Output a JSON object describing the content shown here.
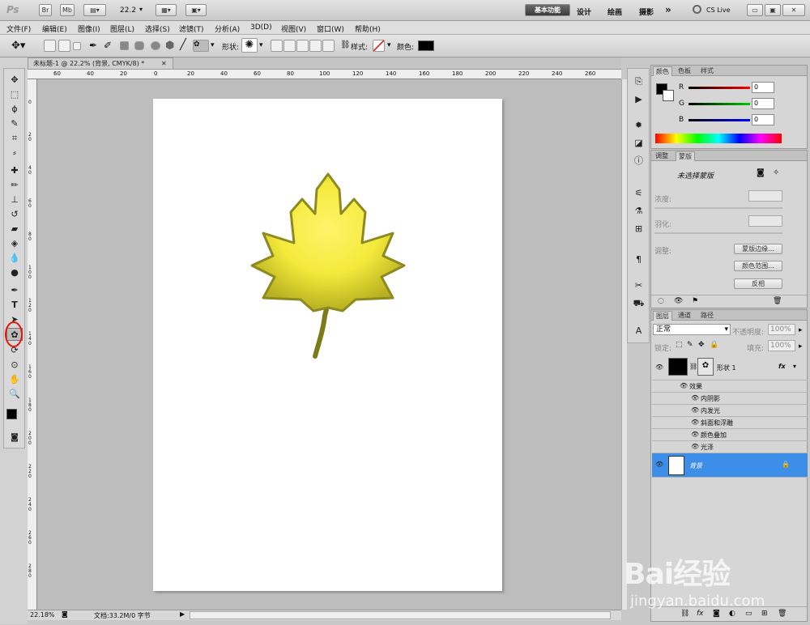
{
  "app": {
    "logo": "Ps",
    "bridge": "Br",
    "minibridge": "Mb",
    "zoom_value": "22.2",
    "workspaces": [
      "基本功能",
      "设计",
      "绘画",
      "摄影"
    ],
    "more": "»",
    "cslive": "CS Live"
  },
  "menu": [
    "文件(F)",
    "编辑(E)",
    "图像(I)",
    "图层(L)",
    "选择(S)",
    "滤镜(T)",
    "分析(A)",
    "3D(D)",
    "视图(V)",
    "窗口(W)",
    "帮助(H)"
  ],
  "options": {
    "shape_label": "形状:",
    "style_label": "样式:",
    "color_label": "颜色:"
  },
  "document": {
    "tab_title": "未标题-1 @ 22.2% (背景, CMYK/8) *",
    "zoom_status": "22.18%",
    "status_text": "文档:33.2M/0 字节"
  },
  "ruler": {
    "h": [
      "60",
      "40",
      "20",
      "0",
      "20",
      "40",
      "60",
      "80",
      "100",
      "120",
      "140",
      "160",
      "180",
      "200",
      "220",
      "240",
      "260"
    ],
    "v": [
      "0",
      "2 0",
      "4 0",
      "6 0",
      "8 0",
      "1 0 0",
      "1 2 0",
      "1 4 0",
      "1 6 0",
      "1 8 0",
      "2 0 0",
      "2 2 0",
      "2 4 0",
      "2 6 0",
      "2 8 0"
    ]
  },
  "color_panel": {
    "tabs": [
      "颜色",
      "色板",
      "样式"
    ],
    "channels": [
      {
        "label": "R",
        "value": "0"
      },
      {
        "label": "G",
        "value": "0"
      },
      {
        "label": "B",
        "value": "0"
      }
    ]
  },
  "masks_panel": {
    "tabs": [
      "调整",
      "蒙版"
    ],
    "title": "未选择蒙版",
    "density": "浓度:",
    "feather": "羽化:",
    "refine": "调整:",
    "btn_edge": "蒙版边缘...",
    "btn_range": "颜色范围...",
    "btn_invert": "反相"
  },
  "layers_panel": {
    "tabs": [
      "图层",
      "通道",
      "路径"
    ],
    "blend": "正常",
    "opacity_label": "不透明度:",
    "opacity": "100%",
    "lock_label": "锁定:",
    "fill_label": "填充:",
    "fill": "100%",
    "shape_layer": "形状 1",
    "fx": "fx",
    "effects_label": "效果",
    "effects": [
      "内阴影",
      "内发光",
      "斜面和浮雕",
      "颜色叠加",
      "光泽"
    ],
    "bg_layer": "背景"
  },
  "watermark": {
    "text": "Bai经验",
    "url": "jingyan.baidu.com"
  },
  "colors": {
    "leaf": "#f2ea3a",
    "leaf_edge": "#8c8a20",
    "selected_layer": "#3d8ee8",
    "annotation": "#e8160c"
  }
}
